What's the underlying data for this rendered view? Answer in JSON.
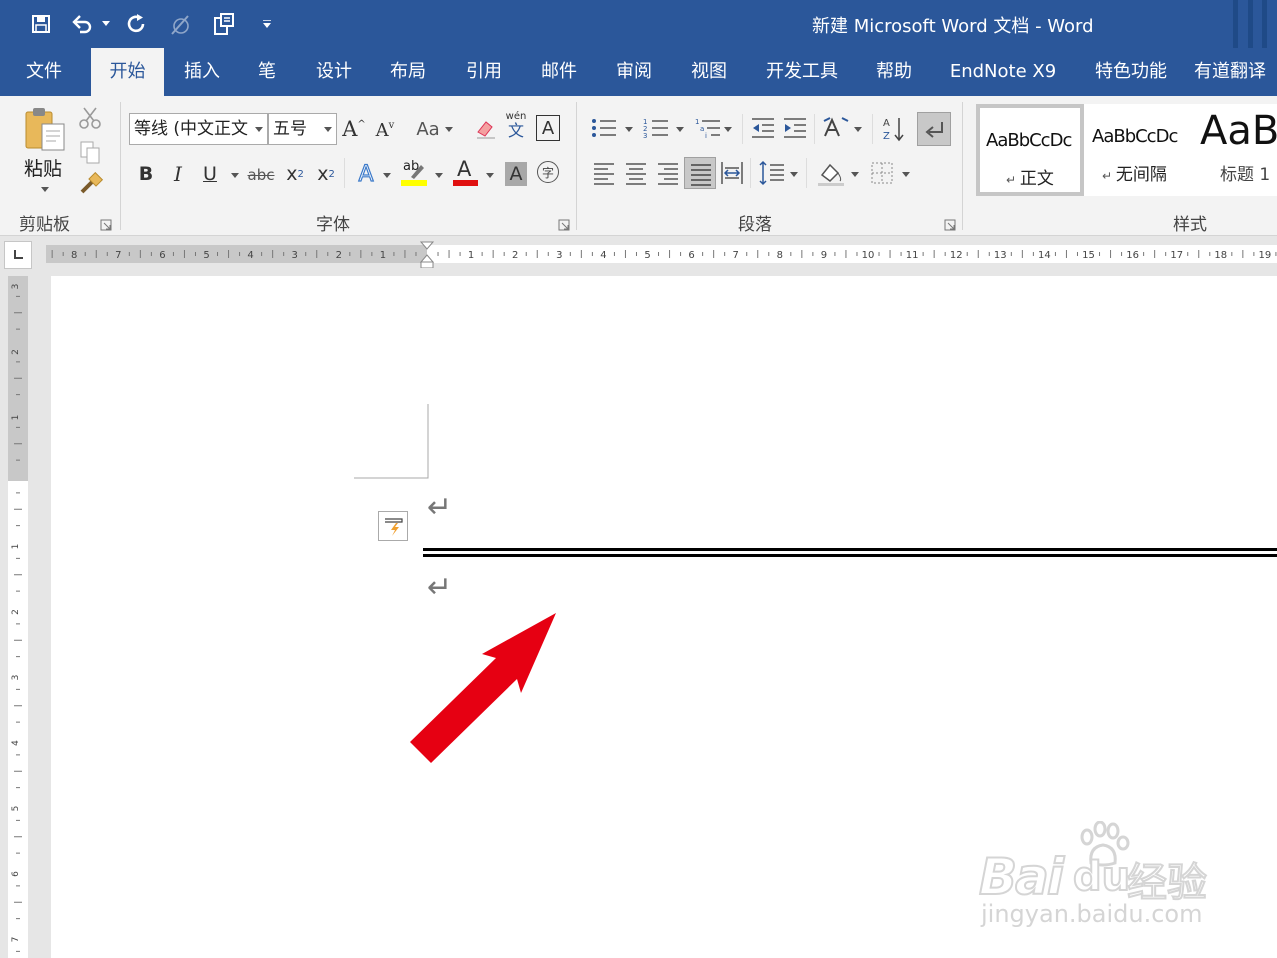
{
  "window": {
    "title": "新建 Microsoft Word 文档  -  Word"
  },
  "qat": {
    "icons": [
      "save-icon",
      "undo-icon",
      "redo-icon",
      "touch-mode-icon",
      "clipboard-icon",
      "customize-qat-icon"
    ]
  },
  "tabs": [
    "文件",
    "开始",
    "插入",
    "笔",
    "设计",
    "布局",
    "引用",
    "邮件",
    "审阅",
    "视图",
    "开发工具",
    "帮助",
    "EndNote X9",
    "特色功能",
    "有道翻译"
  ],
  "active_tab": "开始",
  "ribbon": {
    "clipboard": {
      "paste_label": "粘贴",
      "group_label": "剪贴板"
    },
    "font": {
      "font_name": "等线 (中文正文",
      "font_size": "五号",
      "group_label": "字体",
      "grow_label": "A",
      "shrink_label": "A",
      "case_label": "Aa",
      "phonetic_top": "wén",
      "phonetic_bottom": "文",
      "border_char_label": "A",
      "bold_label": "B",
      "italic_label": "I",
      "underline_label": "U",
      "strike_label": "abc",
      "subscript_label": "x",
      "subscript_sub": "2",
      "superscript_label": "x",
      "superscript_sup": "2",
      "effects_label": "A",
      "highlight_label": "ab",
      "highlight_color": "#ffff00",
      "font_color_label": "A",
      "font_color": "#e01010",
      "shading_label": "A",
      "enclose_label": "字"
    },
    "paragraph": {
      "group_label": "段落"
    },
    "styles": {
      "group_label": "样式",
      "items": [
        {
          "sample": "AaBbCcDc",
          "name": "正文"
        },
        {
          "sample": "AaBbCcDc",
          "name": "无间隔"
        },
        {
          "sample": "AaB",
          "name": "标题 1"
        }
      ]
    }
  },
  "ruler": {
    "left_numbers": [
      "8",
      "7",
      "6",
      "5",
      "4",
      "3",
      "2",
      "1"
    ],
    "right_numbers": [
      "1",
      "2",
      "3",
      "4",
      "5",
      "6",
      "7",
      "8",
      "9",
      "10",
      "11",
      "12",
      "13",
      "14",
      "15",
      "16",
      "17",
      "18",
      "19"
    ],
    "vertical_top": [
      "3",
      "2",
      "1"
    ],
    "vertical_bottom": [
      "1",
      "2",
      "3",
      "4",
      "5",
      "6",
      "7"
    ]
  },
  "document": {
    "paragraph_mark": "↵",
    "border_line": "double"
  },
  "annotation": {
    "arrow_color": "#e60012"
  },
  "watermark": {
    "brand": "Bai",
    "brand2": "du",
    "cn": "经验",
    "url": "jingyan.baidu.com"
  },
  "colors": {
    "accent": "#2b579a"
  }
}
